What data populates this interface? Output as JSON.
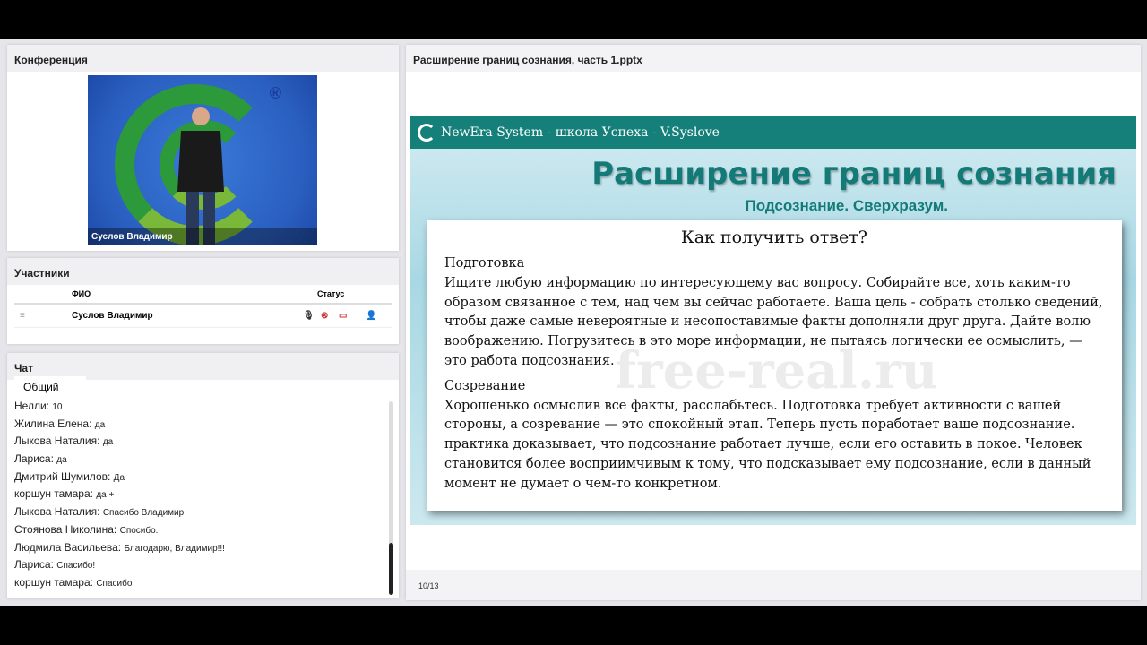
{
  "conference": {
    "title": "Конференция",
    "video_label": "Суслов Владимир",
    "registered": "®"
  },
  "participants": {
    "title": "Участники",
    "col_name": "ФИО",
    "col_status": "Статус",
    "rows": [
      {
        "name": "Суслов Владимир"
      }
    ]
  },
  "chat": {
    "title": "Чат",
    "tab": "Общий",
    "messages": [
      {
        "author": "Нелли:",
        "text": "10"
      },
      {
        "author": "Жилина  Елена:",
        "text": "да"
      },
      {
        "author": "Лыкова Наталия:",
        "text": "да"
      },
      {
        "author": "Лариса:",
        "text": "да"
      },
      {
        "author": "Дмитрий  Шумилов:",
        "text": "Да"
      },
      {
        "author": "коршун тамара:",
        "text": "да +"
      },
      {
        "author": "Лыкова Наталия:",
        "text": "Спасибо Владимир!"
      },
      {
        "author": "Стоянова Николина:",
        "text": "Спосибо."
      },
      {
        "author": "Людмила Васильева:",
        "text": "Благодарю, Владимир!!!"
      },
      {
        "author": "Лариса:",
        "text": "Спасибо!"
      },
      {
        "author": "коршун тамара:",
        "text": "Спасибо"
      }
    ]
  },
  "presentation": {
    "title": "Расширение границ сознания, часть 1.pptx",
    "page": "10/13",
    "slide": {
      "header": "NewEra System - школа Успеха - V.Syslove",
      "title": "Расширение границ сознания",
      "subtitle": "Подсознание. Сверхразум.",
      "watermark": "free-real.ru",
      "question": "Как получить ответ?",
      "sections": [
        {
          "heading": "Подготовка",
          "body": "Ищите любую информацию по интересующему вас вопросу. Собирайте все, хоть каким-то образом связанное с тем, над чем вы сейчас работаете. Ваша цель - собрать столько сведений, чтобы даже самые невероятные и несопоставимые факты дополняли друг друга. Дайте волю воображению. Погрузитесь в это море информации, не пытаясь логически ее осмыслить, — это работа подсознания."
        },
        {
          "heading": "Созревание",
          "body": "Хорошенько осмыслив все факты, расслабьтесь. Подготовка требует активности с вашей стороны, а созревание — это спокойный этап. Теперь пусть поработает ваше подсознание. практика доказывает, что подсознание работает лучше, если его оставить в покое. Человек становится более восприимчивым к тому, что подсказывает ему подсознание, если в данный момент не думает о чем-то конкретном."
        }
      ]
    }
  }
}
